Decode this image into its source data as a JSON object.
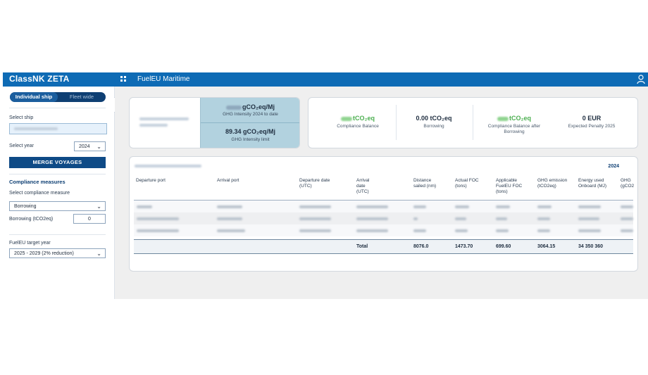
{
  "app": {
    "brand": "ClassNK ZETA",
    "title": "FuelEU Maritime"
  },
  "icons": {
    "apps": "grid-icon",
    "user": "user-icon",
    "collapse": "chevron-left-icon"
  },
  "sidebar": {
    "toggle": {
      "active": "Individual ship",
      "inactive": "Fleet wide"
    },
    "select_ship_label": "Select ship",
    "select_year_label": "Select year",
    "year_value": "2024",
    "merge_button": "MERGE VOYAGES",
    "compliance_heading": "Compliance measures",
    "select_measure_label": "Select compliance measure",
    "measure_value": "Borrowing",
    "borrowing_label": "Borrowing (tCO2eq)",
    "borrowing_value": "0",
    "target_year_label": "FuelEU target year",
    "target_year_value": "2025 - 2029 (2% reduction)"
  },
  "summary": {
    "ghg_intensity_unit": "gCO₂eq/Mj",
    "ghg_intensity_label": "GHG Intensity 2024 to date",
    "ghg_limit_value": "89.34 gCO₂eq/Mj",
    "ghg_limit_label": "GHG Intensity limit",
    "compliance_balance_unit": "tCO₂eq",
    "compliance_balance_label": "Compliance Balance",
    "borrowing_value": "0.00 tCO₂eq",
    "borrowing_label": "Borrowing",
    "balance_after_unit": "tCO₂eq",
    "balance_after_label": "Compliance Balance after Borrowing",
    "penalty_value": "0 EUR",
    "penalty_label": "Expected Penalty 2025"
  },
  "table": {
    "year": "2024",
    "headers": [
      "Departure port",
      "Arrival port",
      "Departure date (UTC)",
      "Arrival date (UTC)",
      "Distance sailed (nm)",
      "Actual FOC (tons)",
      "Applicable FuelEU FOC (tons)",
      "GHG emission (tCO2eq)",
      "Energy used Onboard (MJ)",
      "GHG (gCO2"
    ],
    "totals": {
      "label": "Total",
      "distance": "8076.0",
      "actual_foc": "1473.70",
      "applicable_foc": "699.60",
      "ghg_emission": "3064.15",
      "energy": "34 350 360"
    }
  },
  "colors": {
    "brand": "#0e6bb5",
    "ghg_panel": "#b2d2df",
    "positive": "#8fd48f"
  }
}
